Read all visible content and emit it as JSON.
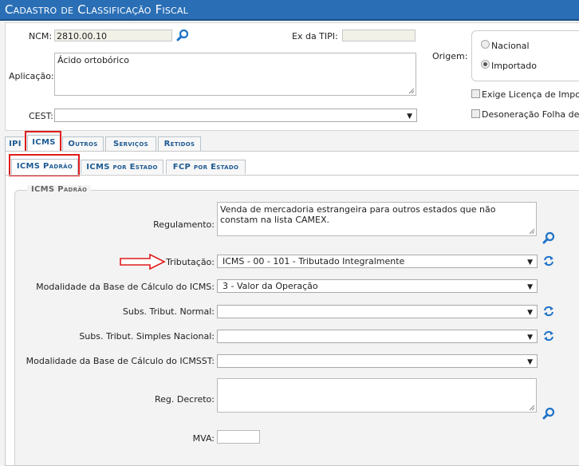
{
  "window": {
    "title": "Cadastro de Classificação Fiscal"
  },
  "top": {
    "ncm_label": "NCM:",
    "ncm_value": "2810.00.10",
    "ex_tipi_label": "Ex da TIPI:",
    "ex_tipi_value": "",
    "aplicacao_label": "Aplicação:",
    "aplicacao_value": "Ácido ortobórico",
    "cest_label": "CEST:",
    "cest_value": "",
    "origem_label": "Origem:",
    "origem_options": [
      "Nacional",
      "Importado"
    ],
    "origem_selected": "Importado",
    "exige_licenca_label": "Exige Licença de Impo",
    "desoneracao_label": "Desoneração Folha de"
  },
  "tabs": [
    "IPI",
    "ICMS",
    "Outros",
    "Serviços",
    "Retidos"
  ],
  "active_tab": "ICMS",
  "subtabs": [
    "ICMS Padrão",
    "ICMS por Estado",
    "FCP por Estado"
  ],
  "active_subtab": "ICMS Padrão",
  "icms_padrao": {
    "legend": "ICMS Padrão",
    "regulamento_label": "Regulamento:",
    "regulamento_value": "Venda de mercadoria estrangeira para outros estados que não constam na lista CAMEX.",
    "tributacao_label": "Tributação:",
    "tributacao_value": "ICMS - 00 - 101 - Tributado Integralmente",
    "mod_bc_icms_label": "Modalidade da Base de Cálculo do ICMS:",
    "mod_bc_icms_value": "3 - Valor da Operação",
    "subs_normal_label": "Subs. Tribut. Normal:",
    "subs_normal_value": "",
    "subs_simples_label": "Subs. Tribut. Simples Nacional:",
    "subs_simples_value": "",
    "mod_bc_icmsst_label": "Modalidade da Base de Cálculo do ICMSST:",
    "mod_bc_icmsst_value": "",
    "reg_decreto_label": "Reg. Decreto:",
    "reg_decreto_value": "",
    "mva_label": "MVA:",
    "mva_value": ""
  },
  "colors": {
    "titlebar": "#2a6fb6",
    "tab_text": "#1e5a92",
    "highlight": "#e01c1c",
    "icon_blue": "#1f73c9"
  }
}
